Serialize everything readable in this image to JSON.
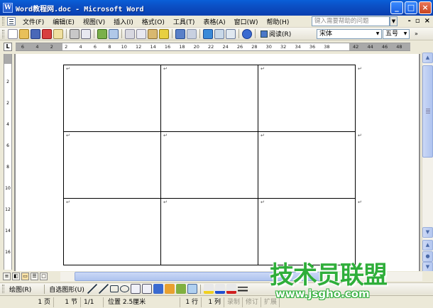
{
  "window": {
    "title": "Word教程网.doc - Microsoft Word",
    "app_icon_letter": "W",
    "minimize": "_",
    "maximize": "□",
    "close": "×"
  },
  "menubar": {
    "items": [
      {
        "label": "文件(F)"
      },
      {
        "label": "编辑(E)"
      },
      {
        "label": "视图(V)"
      },
      {
        "label": "插入(I)"
      },
      {
        "label": "格式(O)"
      },
      {
        "label": "工具(T)"
      },
      {
        "label": "表格(A)"
      },
      {
        "label": "窗口(W)"
      },
      {
        "label": "帮助(H)"
      }
    ],
    "help_placeholder": "键入需要帮助的问题",
    "doc_minimize": "-",
    "doc_restore": "▫",
    "doc_close": "×"
  },
  "toolbar": {
    "read_label": "阅读(R)",
    "font_name": "宋体",
    "font_size": "五号"
  },
  "ruler": {
    "corner": "L",
    "h_labels": [
      "6",
      "4",
      "2",
      "2",
      "4",
      "6",
      "8",
      "10",
      "12",
      "14",
      "16",
      "18",
      "20",
      "22",
      "24",
      "26",
      "28",
      "30",
      "32",
      "34",
      "36",
      "38",
      "42",
      "44",
      "46",
      "48"
    ],
    "v_labels": [
      "2",
      "2",
      "4",
      "6",
      "8",
      "10",
      "12",
      "14",
      "16",
      "18"
    ]
  },
  "document": {
    "paragraph_mark": "↵"
  },
  "drawbar": {
    "draw_label": "绘图(R)",
    "autoshape_label": "自选图形(U)"
  },
  "statusbar": {
    "page": "1 页",
    "section": "1 节",
    "pagecount": "1/1",
    "position": "位置 2.5厘米",
    "line": "1 行",
    "column": "1 列",
    "rec": "录制",
    "trk": "修订",
    "ext": "扩展"
  },
  "watermark": {
    "text": "技术员联盟",
    "url": "www.jsgho.com"
  },
  "colors": {
    "titlebar": "#0a4fc4",
    "watermark_green": "#2fae3a"
  }
}
